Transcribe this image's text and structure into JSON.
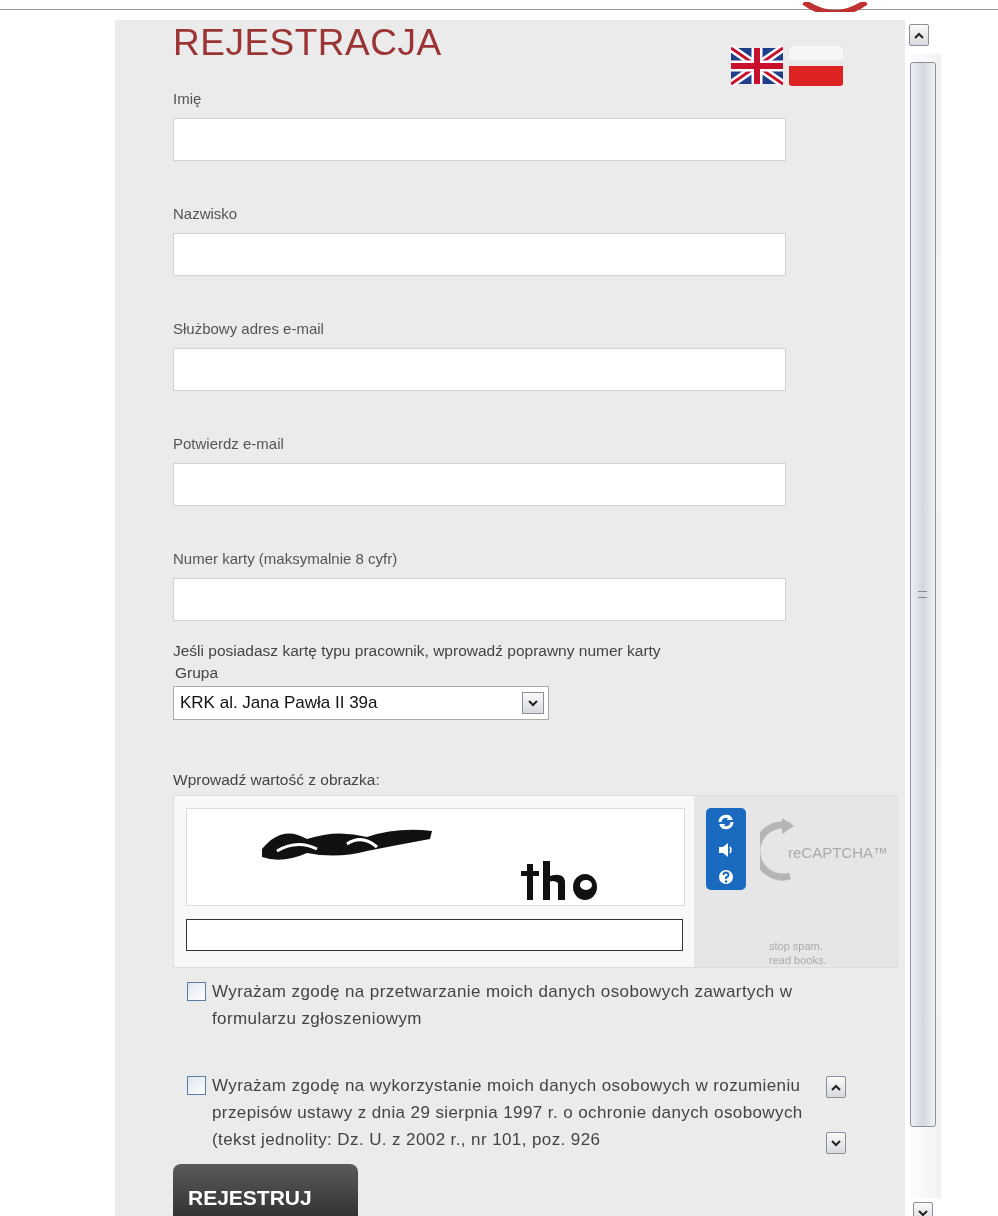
{
  "title": "REJESTRACJA",
  "fields": [
    {
      "label": "Imię"
    },
    {
      "label": "Nazwisko"
    },
    {
      "label": "Służbowy adres e-mail"
    },
    {
      "label": "Potwierdz e-mail"
    },
    {
      "label": "Numer karty  (maksymalnie 8 cyfr)"
    }
  ],
  "card_note": "Jeśli posiadasz kartę typu pracownik, wprowadź poprawny numer karty",
  "group": {
    "label": "Grupa",
    "value": "KRK al. Jana Pawła II 39a"
  },
  "captcha": {
    "label": "Wprowadź wartość z obrazka:",
    "logo": "reCAPTCHA™",
    "slogan": "stop spam. read books."
  },
  "consents": [
    {
      "text": "Wyrażam zgodę na przetwarzanie moich danych osobowych zawartych w formularzu zgłoszeniowym",
      "checked": false,
      "kind": "plain"
    },
    {
      "text": "Wyrażam zgodę na wykorzystanie moich danych osobowych w rozumieniu przepisów ustawy z dnia 29 sierpnia 1997 r. o ochronie danych osobowych (tekst jednolity: Dz. U. z 2002 r., nr 101, poz. 926",
      "checked": false,
      "kind": "scrolling"
    }
  ],
  "submit": "REJESTRUJ"
}
